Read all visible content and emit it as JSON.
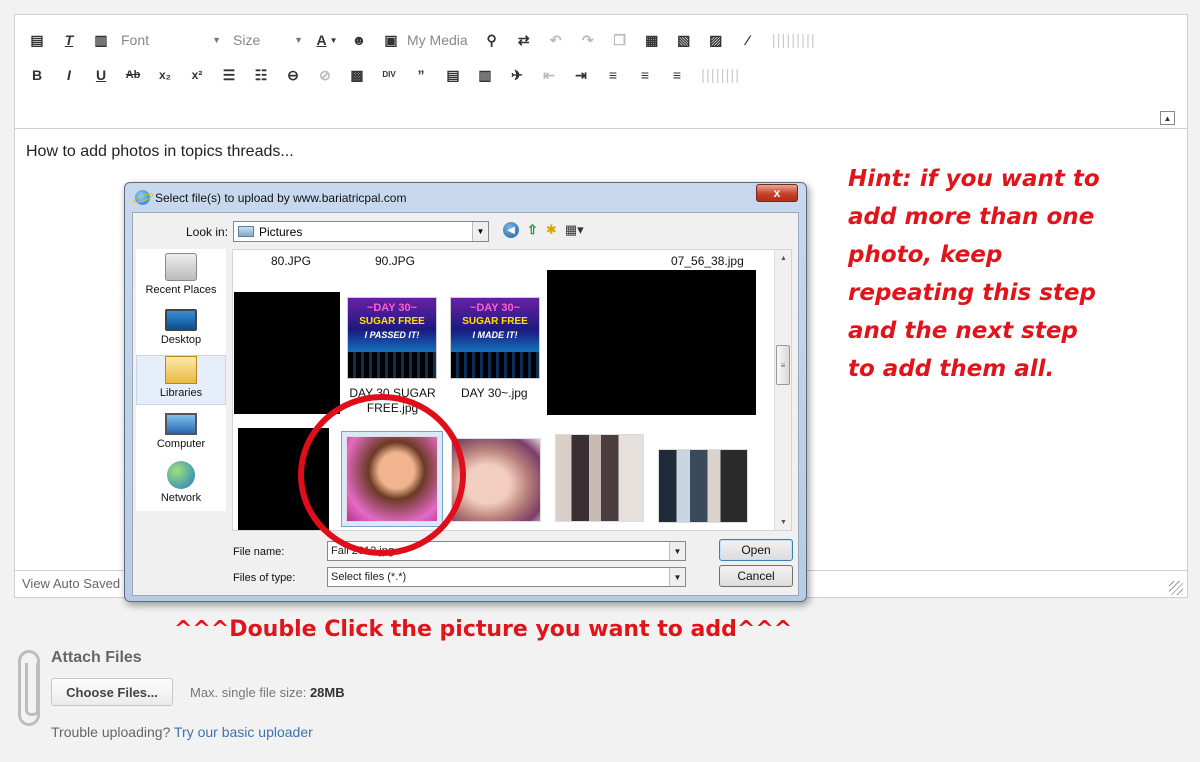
{
  "toolbar": {
    "font_label": "Font",
    "size_label": "Size",
    "my_media_label": "My Media"
  },
  "editor": {
    "content_text": "How to add photos in topics threads...",
    "autosave_label": "View Auto Saved"
  },
  "hint": {
    "lines": [
      "Hint: if you want to",
      "add more than one",
      "photo, keep",
      "repeating this step",
      "and the next step",
      "to add them all."
    ]
  },
  "instruction": "^^^Double Click the picture you want to add^^^",
  "dialog": {
    "title": "Select file(s) to upload by www.bariatricpal.com",
    "close_label": "x",
    "look_in_label": "Look in:",
    "look_in_value": "Pictures",
    "places": [
      "Recent Places",
      "Desktop",
      "Libraries",
      "Computer",
      "Network"
    ],
    "files": {
      "f1": "80.JPG",
      "f2": "90.JPG",
      "f3": "07_56_38.jpg",
      "day1_line1": "DAY 30 SUGAR",
      "day1_line2": "FREE.jpg",
      "day2": "DAY 30~.jpg"
    },
    "day_art": {
      "t1": "~DAY 30~",
      "t2": "SUGAR FREE",
      "t3a": "I PASSED IT!",
      "t3b": "I MADE IT!"
    },
    "file_name_label": "File name:",
    "file_name_value": "Fall 2012.jpg",
    "files_of_type_label": "Files of type:",
    "files_of_type_value": "Select files (*.*)",
    "open_label": "Open",
    "cancel_label": "Cancel"
  },
  "attach": {
    "title": "Attach Files",
    "choose_label": "Choose Files...",
    "max_size_prefix": "Max. single file size: ",
    "max_size_value": "28MB",
    "trouble_text": "Trouble uploading? ",
    "basic_uploader_link": "Try our basic uploader"
  },
  "colors": {
    "accent_red": "#e1141c",
    "link_blue": "#3b73af",
    "dialog_frame": "#b7cbe4"
  }
}
